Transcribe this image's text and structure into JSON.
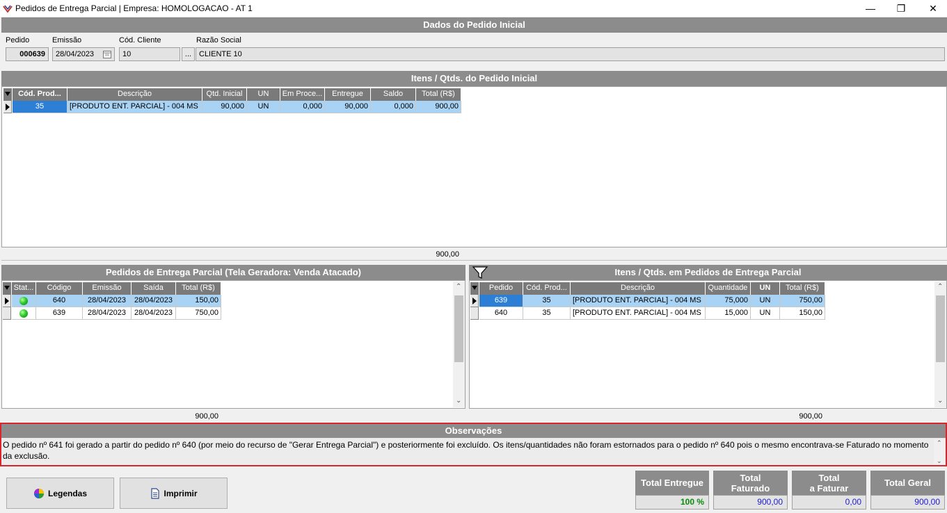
{
  "window": {
    "title": "Pedidos de Entrega Parcial | Empresa: HOMOLOGACAO - AT 1",
    "minimize": "—",
    "restore": "❐",
    "close": "✕"
  },
  "header": {
    "title": "Dados do Pedido Inicial",
    "pedido_label": "Pedido",
    "pedido_value": "000639",
    "emissao_label": "Emissão",
    "emissao_value": "28/04/2023",
    "cod_cliente_label": "Cód. Cliente",
    "cod_cliente_value": "10",
    "lookup_button": "...",
    "razao_label": "Razão Social",
    "razao_value": "CLIENTE 10"
  },
  "itens_inicial": {
    "title": "Itens / Qtds. do Pedido Inicial",
    "columns": [
      "Cód. Prod...",
      "Descrição",
      "Qtd. Inicial",
      "UN",
      "Em Proce...",
      "Entregue",
      "Saldo",
      "Total (R$)"
    ],
    "rows": [
      [
        "35",
        "[PRODUTO ENT. PARCIAL] - 004 MS",
        "90,000",
        "UN",
        "0,000",
        "90,000",
        "0,000",
        "900,00"
      ]
    ],
    "footer_total": "900,00"
  },
  "pedidos_parcial": {
    "title": "Pedidos de Entrega Parcial (Tela Geradora: Venda Atacado)",
    "columns": [
      "Stat...",
      "Código",
      "Emissão",
      "Saída",
      "Total (R$)"
    ],
    "rows": [
      [
        "",
        "640",
        "28/04/2023",
        "28/04/2023",
        "150,00"
      ],
      [
        "",
        "639",
        "28/04/2023",
        "28/04/2023",
        "750,00"
      ]
    ],
    "footer_total": "900,00"
  },
  "itens_parcial": {
    "title": "Itens / Qtds. em Pedidos de Entrega Parcial",
    "columns": [
      "Pedido",
      "Cód. Prod...",
      "Descrição",
      "Quantidade",
      "UN",
      "Total (R$)"
    ],
    "rows": [
      [
        "639",
        "35",
        "[PRODUTO ENT. PARCIAL] - 004 MS",
        "75,000",
        "UN",
        "750,00"
      ],
      [
        "640",
        "35",
        "[PRODUTO ENT. PARCIAL] - 004 MS",
        "15,000",
        "UN",
        "150,00"
      ]
    ],
    "footer_total": "900,00"
  },
  "observacoes": {
    "title": "Observações",
    "text": "O pedido nº 641 foi gerado a partir do pedido nº 640 (por meio do recurso de \"Gerar Entrega Parcial\") e posteriormente foi excluído. Os itens/quantidades não foram estornados para o pedido nº 640 pois o mesmo encontrava-se Faturado no momento da exclusão."
  },
  "buttons": {
    "legendas": "Legendas",
    "imprimir": "Imprimir"
  },
  "totals": {
    "entregue_label": "Total Entregue",
    "entregue_value": "100 %",
    "faturado_label_1": "Total",
    "faturado_label_2": "Faturado",
    "faturado_value": "900,00",
    "afaturar_label_1": "Total",
    "afaturar_label_2": "a Faturar",
    "afaturar_value": "0,00",
    "geral_label": "Total Geral",
    "geral_value": "900,00"
  },
  "colors": {
    "header_gray": "#8c8c8c",
    "selection_blue": "#a9d3f5",
    "obs_border": "#d9262c",
    "value_blue": "#1b1bd6",
    "percent_green": "#0a8a0a"
  }
}
